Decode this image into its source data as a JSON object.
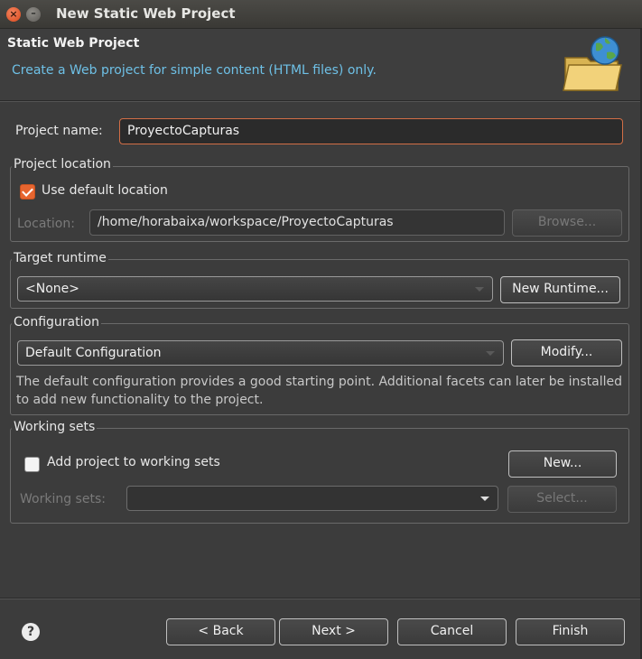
{
  "window": {
    "title": "New Static Web Project"
  },
  "header": {
    "title": "Static Web Project",
    "description": "Create a Web project for simple content (HTML files) only."
  },
  "project_name": {
    "label": "Project name:",
    "value": "ProyectoCapturas"
  },
  "project_location": {
    "group_title": "Project location",
    "use_default_label": "Use default location",
    "use_default_checked": true,
    "location_label": "Location:",
    "location_value": "/home/horabaixa/workspace/ProyectoCapturas",
    "browse_label": "Browse..."
  },
  "target_runtime": {
    "group_title": "Target runtime",
    "selected": "<None>",
    "new_runtime_label": "New Runtime..."
  },
  "configuration": {
    "group_title": "Configuration",
    "selected": "Default Configuration",
    "modify_label": "Modify...",
    "description": "The default configuration provides a good starting point. Additional facets can later be installed to add new functionality to the project."
  },
  "working_sets": {
    "group_title": "Working sets",
    "add_label": "Add project to working sets",
    "add_checked": false,
    "new_label": "New...",
    "sets_label": "Working sets:",
    "sets_value": "",
    "select_label": "Select..."
  },
  "footer": {
    "help_glyph": "?",
    "back_label": "< Back",
    "next_label": "Next >",
    "cancel_label": "Cancel",
    "finish_label": "Finish"
  },
  "icons": {
    "close": "close-icon",
    "minimize": "minimize-icon",
    "wizard": "globe-folder-icon",
    "help": "help-icon"
  },
  "colors": {
    "accent": "#e7652f",
    "description_text": "#6ec0e6",
    "background": "#3c3c3c"
  }
}
